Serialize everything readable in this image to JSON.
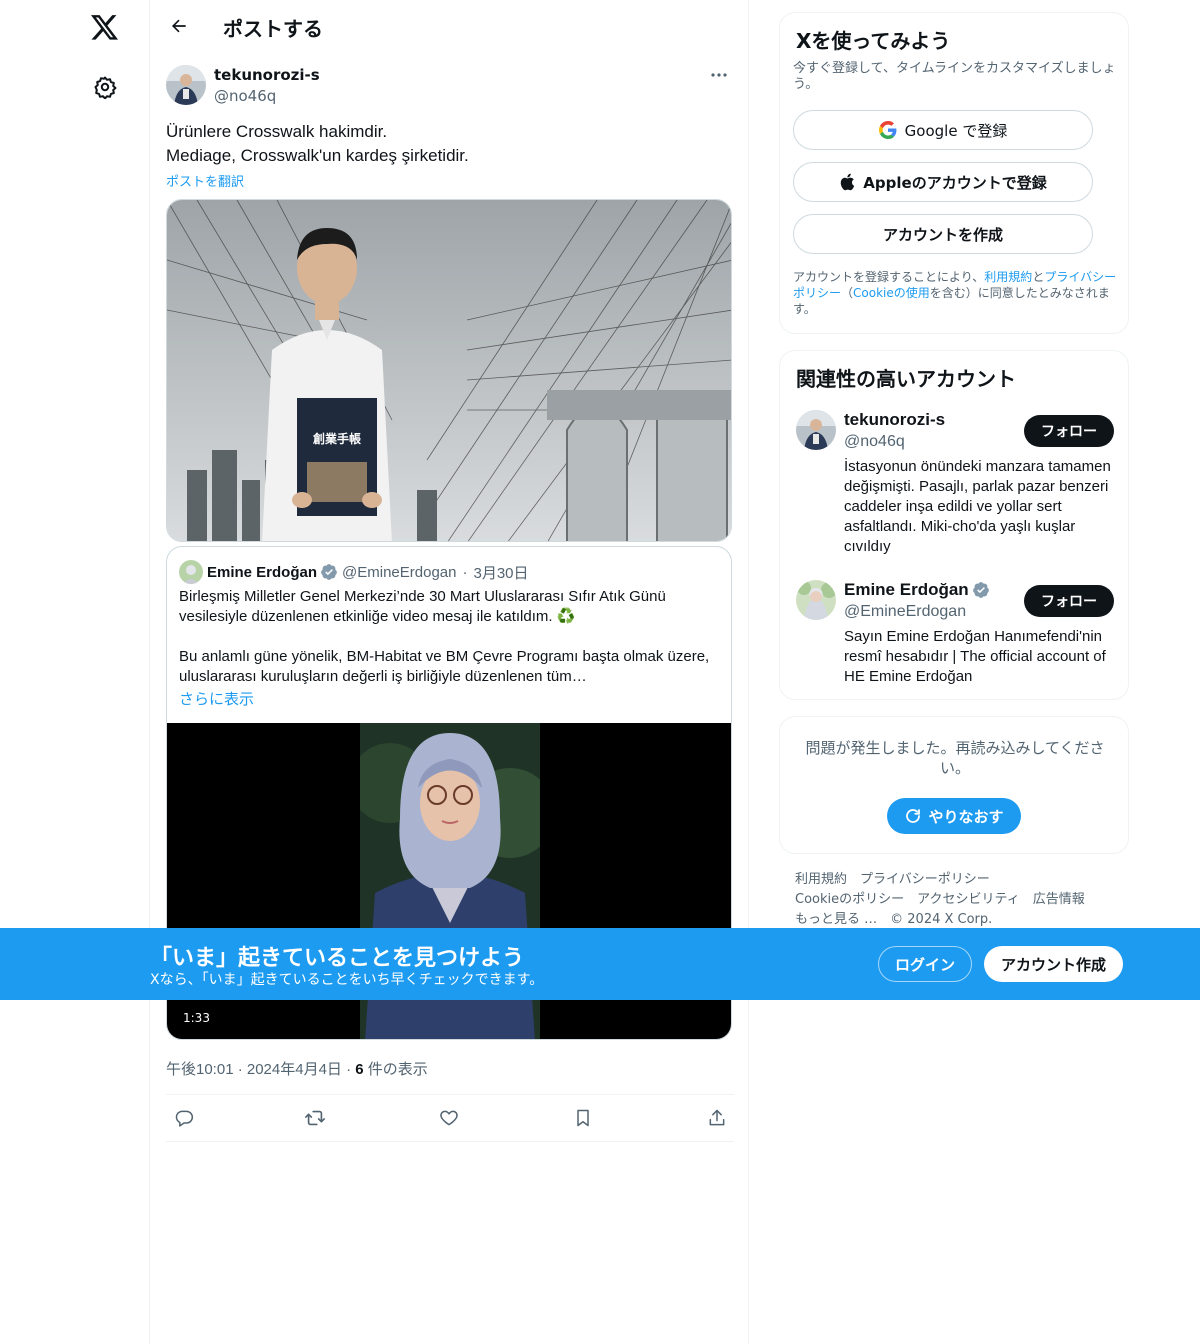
{
  "nav": {
    "logo_icon": "x-logo-icon",
    "settings_icon": "gear-icon"
  },
  "header": {
    "title": "ポストする",
    "back_icon": "arrow-left-icon"
  },
  "tweet": {
    "author_name": "tekunorozi-s",
    "author_handle": "@no46q",
    "text_line1": "Ürünlere Crosswalk hakimdir.",
    "text_line2": "Mediage, Crosswalk'un kardeş şirketidir.",
    "translate": "ポストを翻訳",
    "photo_book_title": "創業手帳",
    "timestamp": "午後10:01 · 2024年4月4日",
    "meta_sep": " · ",
    "views_count": "6",
    "views_label": " 件の表示"
  },
  "quote": {
    "name": "Emine Erdoğan",
    "handle": "@EmineErdogan",
    "separator": "·",
    "date": "3月30日",
    "para1": "Birleşmiş Milletler Genel Merkezi’nde 30 Mart Uluslararası Sıfır Atık Günü vesilesiyle düzenlenen etkinliğe video mesaj ile katıldım. ♻️",
    "para2": "Bu anlamlı güne yönelik, BM-Habitat ve BM Çevre Programı başta olmak üzere, uluslararası kuruluşların değerli iş birliğiyle düzenlenen tüm…",
    "show_more": "さらに表示",
    "video_duration": "1:33"
  },
  "sidebar": {
    "signup": {
      "title": "Xを使ってみよう",
      "subtitle": "今すぐ登録して、タイムラインをカスタマイズしましょう。",
      "google_label": "Google で登録",
      "apple_label": "Appleのアカウントで登録",
      "create_label": "アカウントを作成",
      "legal_pre": "アカウントを登録することにより、",
      "legal_terms": "利用規約",
      "legal_and": "と",
      "legal_privacy": "プライバシーポリシー",
      "legal_paren_open": "（",
      "legal_cookie": "Cookieの使用",
      "legal_post": "を含む）に同意したとみなされます。"
    },
    "recs": {
      "title": "関連性の高いアカウント",
      "items": [
        {
          "name": "tekunorozi-s",
          "handle": "@no46q",
          "bio": "İstasyonun önündeki manzara tamamen değişmişti. Pasajlı, parlak pazar benzeri caddeler inşa edildi ve yollar sert asfaltlandı. Miki-cho'da yaşlı kuşlar cıvıldıy",
          "follow": "フォロー"
        },
        {
          "name": "Emine Erdoğan",
          "handle": "@EmineErdogan",
          "bio": "Sayın Emine Erdoğan Hanımefendi'nin resmî hesabıdır | The official account of HE Emine Erdoğan",
          "follow": "フォロー"
        }
      ]
    },
    "error": {
      "message": "問題が発生しました。再読み込みしてください。",
      "retry": "やりなおす"
    },
    "footer": [
      "利用規約",
      "プライバシーポリシー",
      "Cookieのポリシー",
      "アクセシビリティ",
      "広告情報",
      "もっと見る …",
      "© 2024 X Corp."
    ]
  },
  "banner": {
    "title": "「いま」起きていることを見つけよう",
    "subtitle": "Xなら、「いま」起きていることをいち早くチェックできます。",
    "login": "ログイン",
    "signup": "アカウント作成"
  },
  "colors": {
    "accent": "#1d9bf0",
    "text": "#0f1419",
    "muted": "#536471",
    "border": "#cfd9de"
  }
}
